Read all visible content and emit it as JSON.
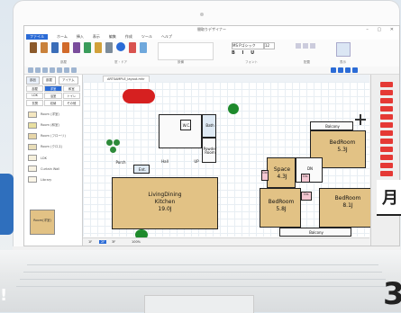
{
  "app": {
    "window_title": "間取りデザイナー",
    "menus": [
      "ファイル",
      "ホーム",
      "挿入",
      "表示",
      "編集",
      "作成",
      "ツール",
      "ヘルプ"
    ],
    "ribbon_groups": [
      "部屋",
      "窓・ドア",
      "設備",
      "フォント",
      "配置",
      "表示"
    ],
    "font_name": "MS Pゴシック",
    "font_size": "12",
    "document_tab": "ARTSAMPLE_layout.mhr"
  },
  "sidepanel": {
    "tabs": [
      "部品",
      "部屋",
      "アイテム"
    ],
    "filters": [
      "部屋",
      "洋室",
      "和室",
      "LDK",
      "浴室",
      "トイレ",
      "玄関",
      "収納",
      "その他"
    ],
    "items": [
      {
        "label": "Room (洋室)",
        "color": "#f4e7c0"
      },
      {
        "label": "Room (和室)",
        "color": "#e8dfa0"
      },
      {
        "label": "Room (フローリ)",
        "color": "#e7d6a8"
      },
      {
        "label": "Room (クロス)",
        "color": "#e8ddb8"
      },
      {
        "label": "LDK",
        "color": "#f6f0dc"
      },
      {
        "label": "Curtain Wall",
        "color": "#f7f2e2"
      },
      {
        "label": "Library",
        "color": "#fbf6e8"
      }
    ],
    "preview_label": "Room(洋室)"
  },
  "floorplan": {
    "rooms": {
      "porch": "Porch",
      "ent": "Ent.",
      "hall": "Hall",
      "wc": "W.C.",
      "bath": "Bath",
      "powder": "Powder Room",
      "up": "UP",
      "living_1": "LivingDining",
      "living_2": "Kitchen",
      "living_size": "19.0J",
      "balcony_top": "Balcony",
      "bedroom_a": "BedRoom",
      "bedroom_a_size": "5.3J",
      "space": "Space",
      "space_size": "4.3J",
      "bedroom_b": "BedRoom",
      "bedroom_b_size": "5.8J",
      "bedroom_c": "BedRoom",
      "bedroom_c_size": "8.1J",
      "closet": "Clo.",
      "balcony_bottom": "Balcony",
      "down": "DN"
    }
  },
  "statusbar": {
    "items": [
      "1F",
      "2F",
      "3F"
    ],
    "zoom": "100%"
  },
  "overlay": {
    "badge_text": "月",
    "corner_text": "3"
  },
  "colors": {
    "floor": "#e2c285",
    "accent": "#2b6bd6",
    "right_panel_button": "#e53935",
    "car": "#d62020",
    "tree": "#1e8a2c"
  }
}
